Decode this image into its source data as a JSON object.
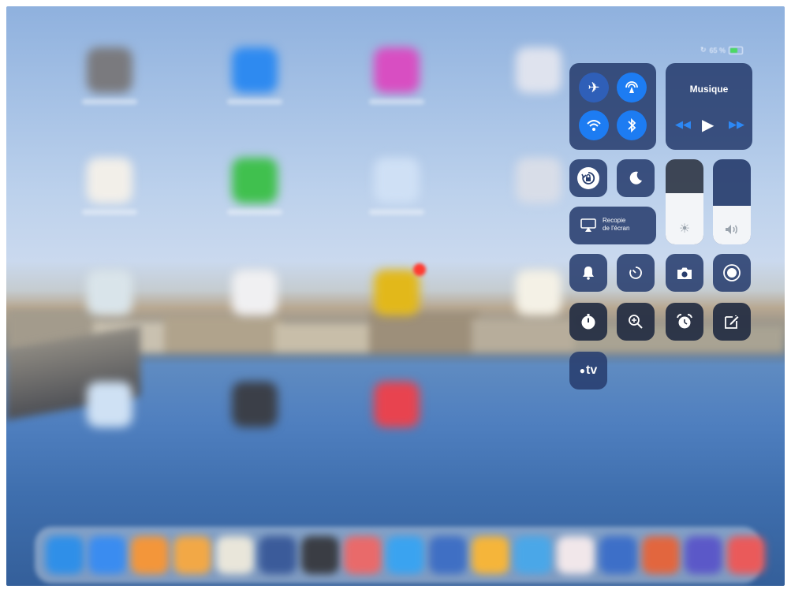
{
  "status_bar": {
    "battery_text": "65 %",
    "battery_level": 0.65
  },
  "control_center": {
    "music": {
      "title": "Musique"
    },
    "screen_mirroring": {
      "line1": "Recopie",
      "line2": "de l'écran"
    },
    "brightness_level": 0.6,
    "volume_level": 0.45,
    "apple_tv": {
      "label": "tv"
    }
  },
  "colors": {
    "accent_blue": "#1d7cf2",
    "tile": "#283e6e"
  }
}
